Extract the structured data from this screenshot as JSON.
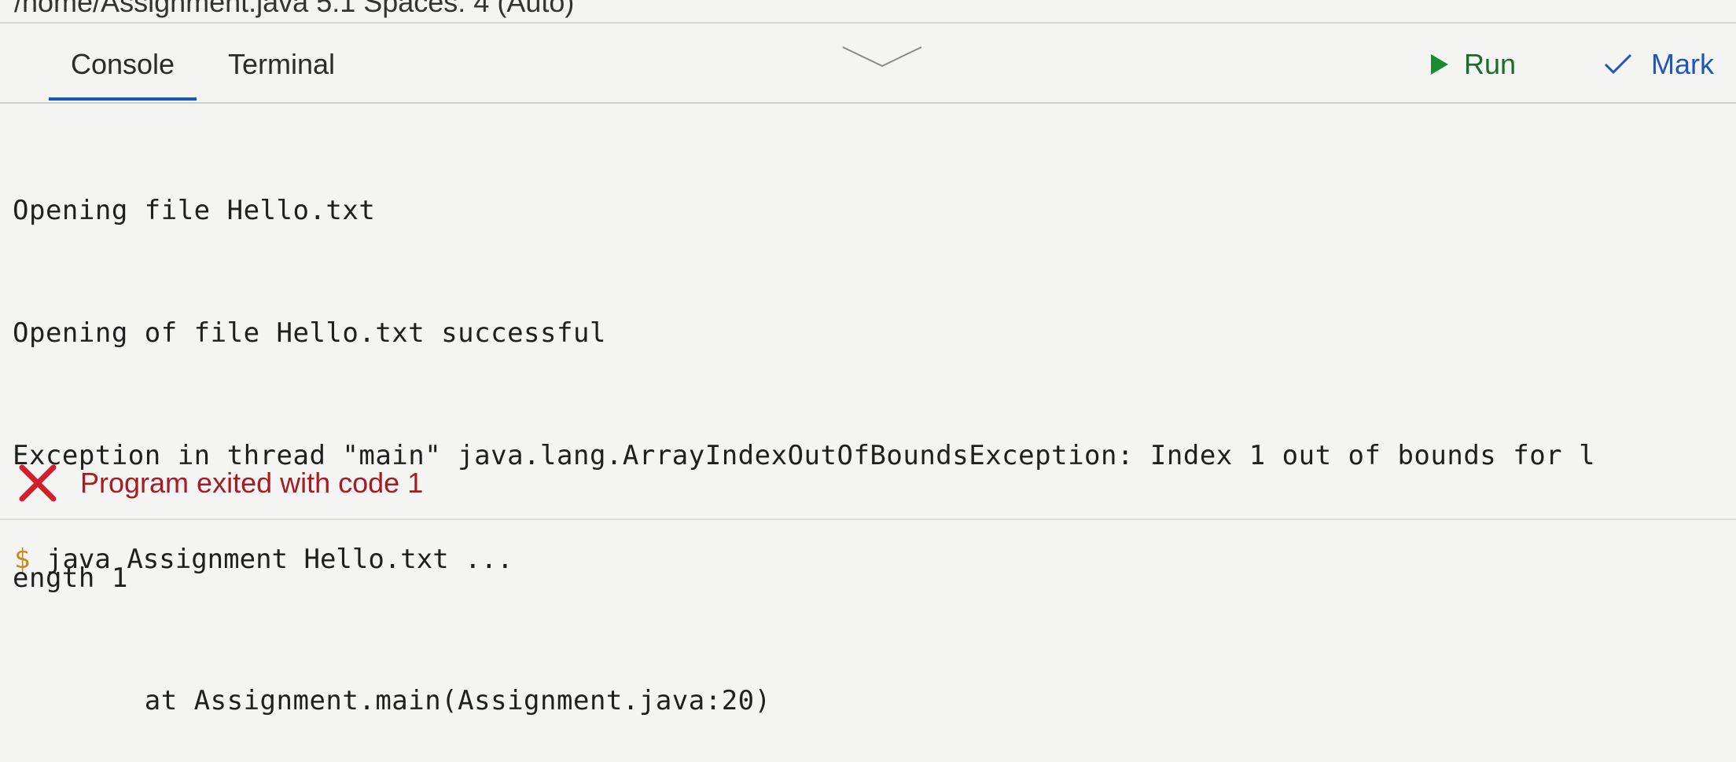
{
  "status_bar": {
    "text": "/home/Assignment.java  5:1   Spaces: 4 (Auto)"
  },
  "tabs": [
    {
      "label": "Console",
      "active": true
    },
    {
      "label": "Terminal",
      "active": false
    }
  ],
  "actions": {
    "run_label": "Run",
    "mark_label": "Mark"
  },
  "console": {
    "lines": [
      "Opening file Hello.txt",
      "Opening of file Hello.txt successful",
      "Exception in thread \"main\" java.lang.ArrayIndexOutOfBoundsException: Index 1 out of bounds for l",
      "ength 1",
      "        at Assignment.main(Assignment.java:20)"
    ]
  },
  "exit_status": {
    "text": "Program exited with code 1",
    "icon": "x-icon"
  },
  "terminal_prompt": {
    "symbol": "$",
    "command": "java Assignment Hello.txt ..."
  },
  "colors": {
    "run_green": "#1c6b2d",
    "mark_blue": "#1f57b8",
    "error_red": "#a61c24",
    "tab_underline": "#1f57b8"
  }
}
